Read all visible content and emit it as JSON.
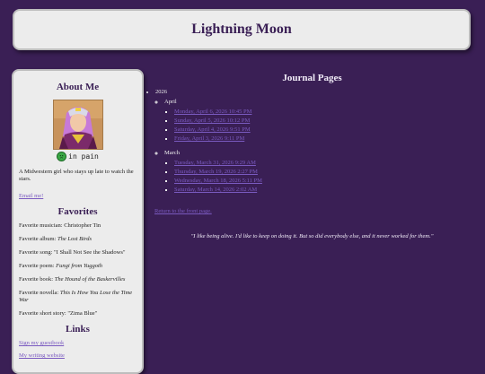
{
  "site": {
    "title": "Lightning Moon"
  },
  "sidebar": {
    "about_title": "About Me",
    "status_text": "in pain",
    "bio": "A Midwestern girl who stays up late to watch the stars.",
    "email_label": "Email me!",
    "favorites_title": "Favorites",
    "favorites": [
      {
        "label": "Favorite musician: ",
        "value": "Christopher Tin",
        "italic": false
      },
      {
        "label": "Favorite album: ",
        "value": "The Lost Birds",
        "italic": true
      },
      {
        "label": "Favorite song: ",
        "value": "\"I Shall Not See the Shadows\"",
        "italic": false
      },
      {
        "label": "Favorite poem: ",
        "value": "Fungi from Yuggoth",
        "italic": true
      },
      {
        "label": "Favorite book: ",
        "value": "The Hound of the Baskervilles",
        "italic": true
      },
      {
        "label": "Favorite novella: ",
        "value": "This Is How You Lose the Time War",
        "italic": true
      },
      {
        "label": "Favorite short story: ",
        "value": "\"Zima Blue\"",
        "italic": false
      }
    ],
    "links_title": "Links",
    "links": [
      {
        "label": "Sign my guestbook"
      },
      {
        "label": "My writing website"
      }
    ]
  },
  "main": {
    "title": "Journal Pages",
    "year": "2026",
    "months": [
      {
        "name": "April",
        "entries": [
          "Monday, April 6, 2026 10:45 PM",
          "Sunday, April 5, 2026 10:12 PM",
          "Saturday, April 4, 2026 9:51 PM",
          "Friday, April 3, 2026 9:11 PM"
        ]
      },
      {
        "name": "March",
        "entries": [
          "Tuesday, March 31, 2026 9:29 AM",
          "Thursday, March 19, 2026 2:27 PM",
          "Wednesday, March 18, 2026 5:11 PM",
          "Saturday, March 14, 2026 2:02 AM"
        ]
      }
    ],
    "back_link": "Return to the front page.",
    "quote": "\"I like being alive. I'd like to keep on doing it. But so did everybody else, and it never worked for them.\""
  },
  "colors": {
    "background": "#3a1f55",
    "panel": "#ececec",
    "link": "#7a5ac0",
    "status_green": "#3aa845"
  }
}
